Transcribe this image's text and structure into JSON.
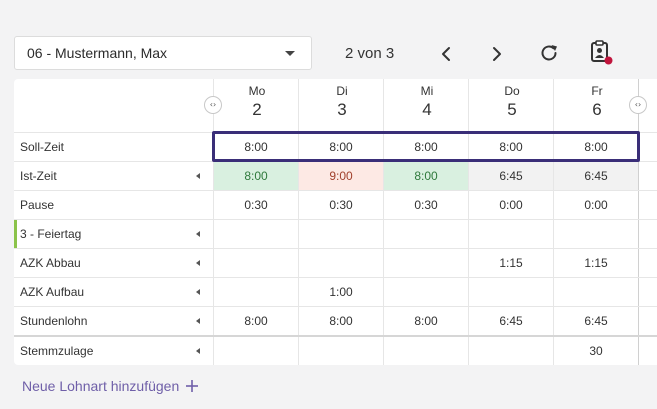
{
  "employee_select": {
    "value": "06 - Mustermann, Max"
  },
  "pager": {
    "text": "2 von 3"
  },
  "toolbar": {
    "prev_icon": "chevron-left-icon",
    "next_icon": "chevron-right-icon",
    "refresh_icon": "refresh-icon",
    "clipboard_icon": "clipboard-user-icon",
    "notification_color": "#c0143c"
  },
  "scroll_controls": {
    "left_glyph": "‹›",
    "right_glyph": "‹›"
  },
  "days": [
    {
      "name": "Mo",
      "num": "2"
    },
    {
      "name": "Di",
      "num": "3"
    },
    {
      "name": "Mi",
      "num": "4"
    },
    {
      "name": "Do",
      "num": "5"
    },
    {
      "name": "Fr",
      "num": "6"
    }
  ],
  "rows": [
    {
      "label": "Soll-Zeit",
      "expandable": false,
      "values": [
        "8:00",
        "8:00",
        "8:00",
        "8:00",
        "8:00"
      ],
      "styles": [
        "",
        "",
        "",
        "",
        ""
      ]
    },
    {
      "label": "Ist-Zeit",
      "expandable": true,
      "values": [
        "8:00",
        "9:00",
        "8:00",
        "6:45",
        "6:45"
      ],
      "styles": [
        "green",
        "red",
        "green",
        "grey",
        "grey"
      ]
    },
    {
      "label": "Pause",
      "expandable": false,
      "values": [
        "0:30",
        "0:30",
        "0:30",
        "0:00",
        "0:00"
      ],
      "styles": [
        "",
        "",
        "",
        "",
        ""
      ]
    },
    {
      "label": "3 - Feiertag",
      "expandable": true,
      "accent": true,
      "values": [
        "",
        "",
        "",
        "",
        ""
      ],
      "styles": [
        "",
        "",
        "",
        "",
        ""
      ]
    },
    {
      "label": "AZK Abbau",
      "expandable": true,
      "values": [
        "",
        "",
        "",
        "1:15",
        "1:15"
      ],
      "styles": [
        "",
        "",
        "",
        "",
        ""
      ]
    },
    {
      "label": "AZK Aufbau",
      "expandable": true,
      "values": [
        "",
        "1:00",
        "",
        "",
        ""
      ],
      "styles": [
        "",
        "",
        "",
        "",
        ""
      ]
    },
    {
      "label": "Stundenlohn",
      "expandable": true,
      "values": [
        "8:00",
        "8:00",
        "8:00",
        "6:45",
        "6:45"
      ],
      "styles": [
        "",
        "",
        "",
        "",
        ""
      ]
    },
    {
      "label": "Stemmzulage",
      "expandable": true,
      "values": [
        "",
        "",
        "",
        "",
        "30"
      ],
      "styles": [
        "",
        "",
        "",
        "",
        ""
      ]
    }
  ],
  "add_wage_type": {
    "label": "Neue Lohnart hinzufügen",
    "icon": "plus-icon"
  },
  "colors": {
    "accent": "#3a2e78",
    "link": "#6f5fa8",
    "holiday_bar": "#8bc34a"
  }
}
